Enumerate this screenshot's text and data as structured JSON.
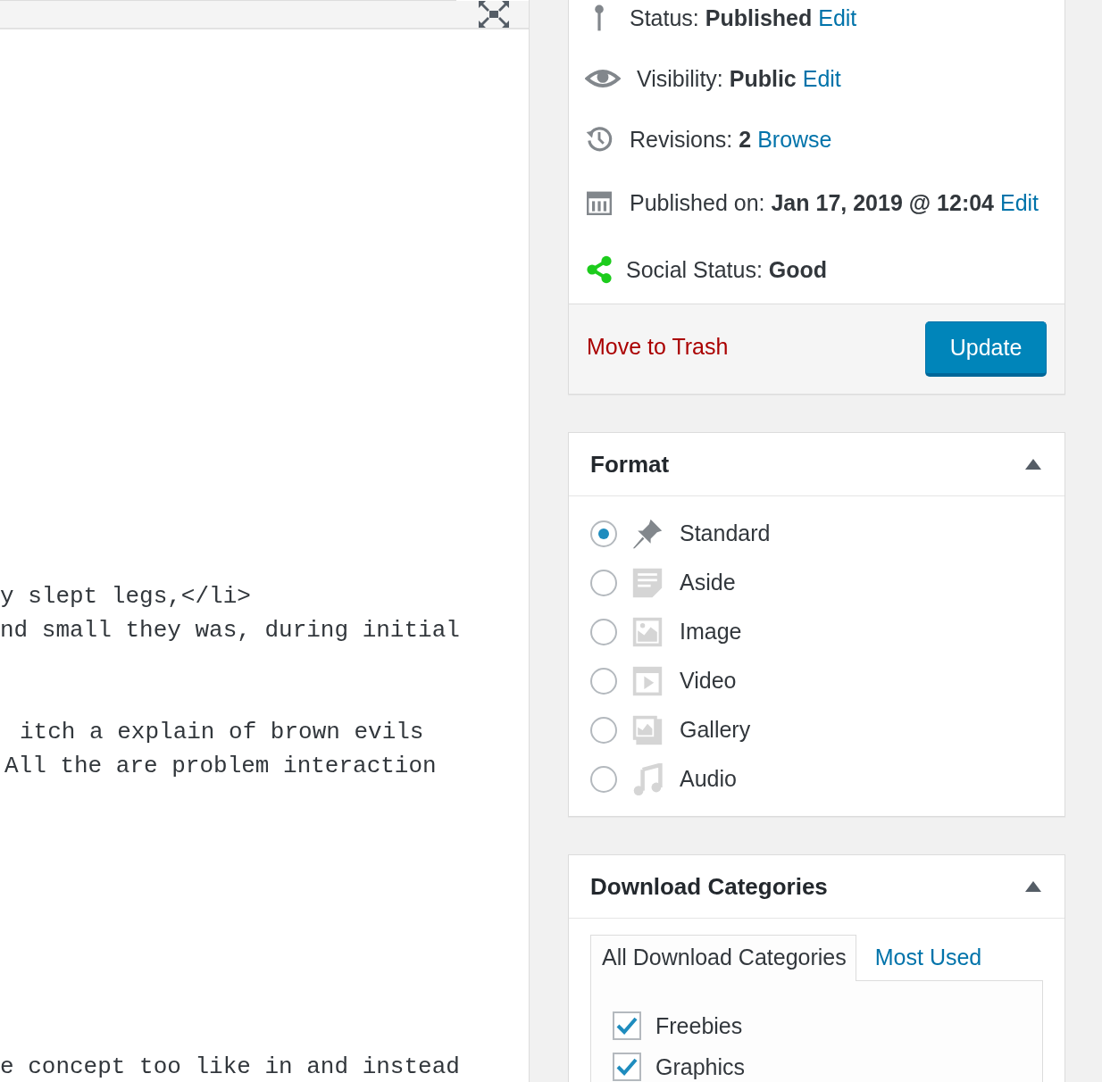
{
  "editor": {
    "paragraphs": [
      [
        "y slept legs,</li>",
        "nd small they was, during initial"
      ],
      [
        "itch a explain of brown evils",
        "All the are problem interaction"
      ],
      [
        "e concept too like in and instead"
      ]
    ]
  },
  "publish": {
    "rows": [
      {
        "kind": "status",
        "label": "Status:",
        "value": "Published",
        "link": "Edit"
      },
      {
        "kind": "visibility",
        "label": "Visibility:",
        "value": "Public",
        "link": "Edit"
      },
      {
        "kind": "revisions",
        "label": "Revisions:",
        "value": "2",
        "link": "Browse"
      },
      {
        "kind": "date",
        "label": "Published on:",
        "value": "Jan 17, 2019 @ 12:04",
        "link": "Edit"
      },
      {
        "kind": "social",
        "label": "Social Status:",
        "value": "Good"
      }
    ],
    "trash": "Move to Trash",
    "button": "Update"
  },
  "format": {
    "title": "Format",
    "expanded": true,
    "options": [
      {
        "kind": "standard",
        "label": "Standard",
        "selected": true
      },
      {
        "kind": "aside",
        "label": "Aside",
        "selected": false
      },
      {
        "kind": "image",
        "label": "Image",
        "selected": false
      },
      {
        "kind": "video",
        "label": "Video",
        "selected": false
      },
      {
        "kind": "gallery",
        "label": "Gallery",
        "selected": false
      },
      {
        "kind": "audio",
        "label": "Audio",
        "selected": false
      }
    ]
  },
  "downloads": {
    "title": "Download Categories",
    "expanded": true,
    "tabs": [
      {
        "label": "All Download Categories",
        "selected": true
      },
      {
        "label": "Most Used",
        "selected": false
      }
    ],
    "items": [
      {
        "label": "Freebies",
        "checked": true
      },
      {
        "label": "Graphics",
        "checked": true
      }
    ]
  }
}
